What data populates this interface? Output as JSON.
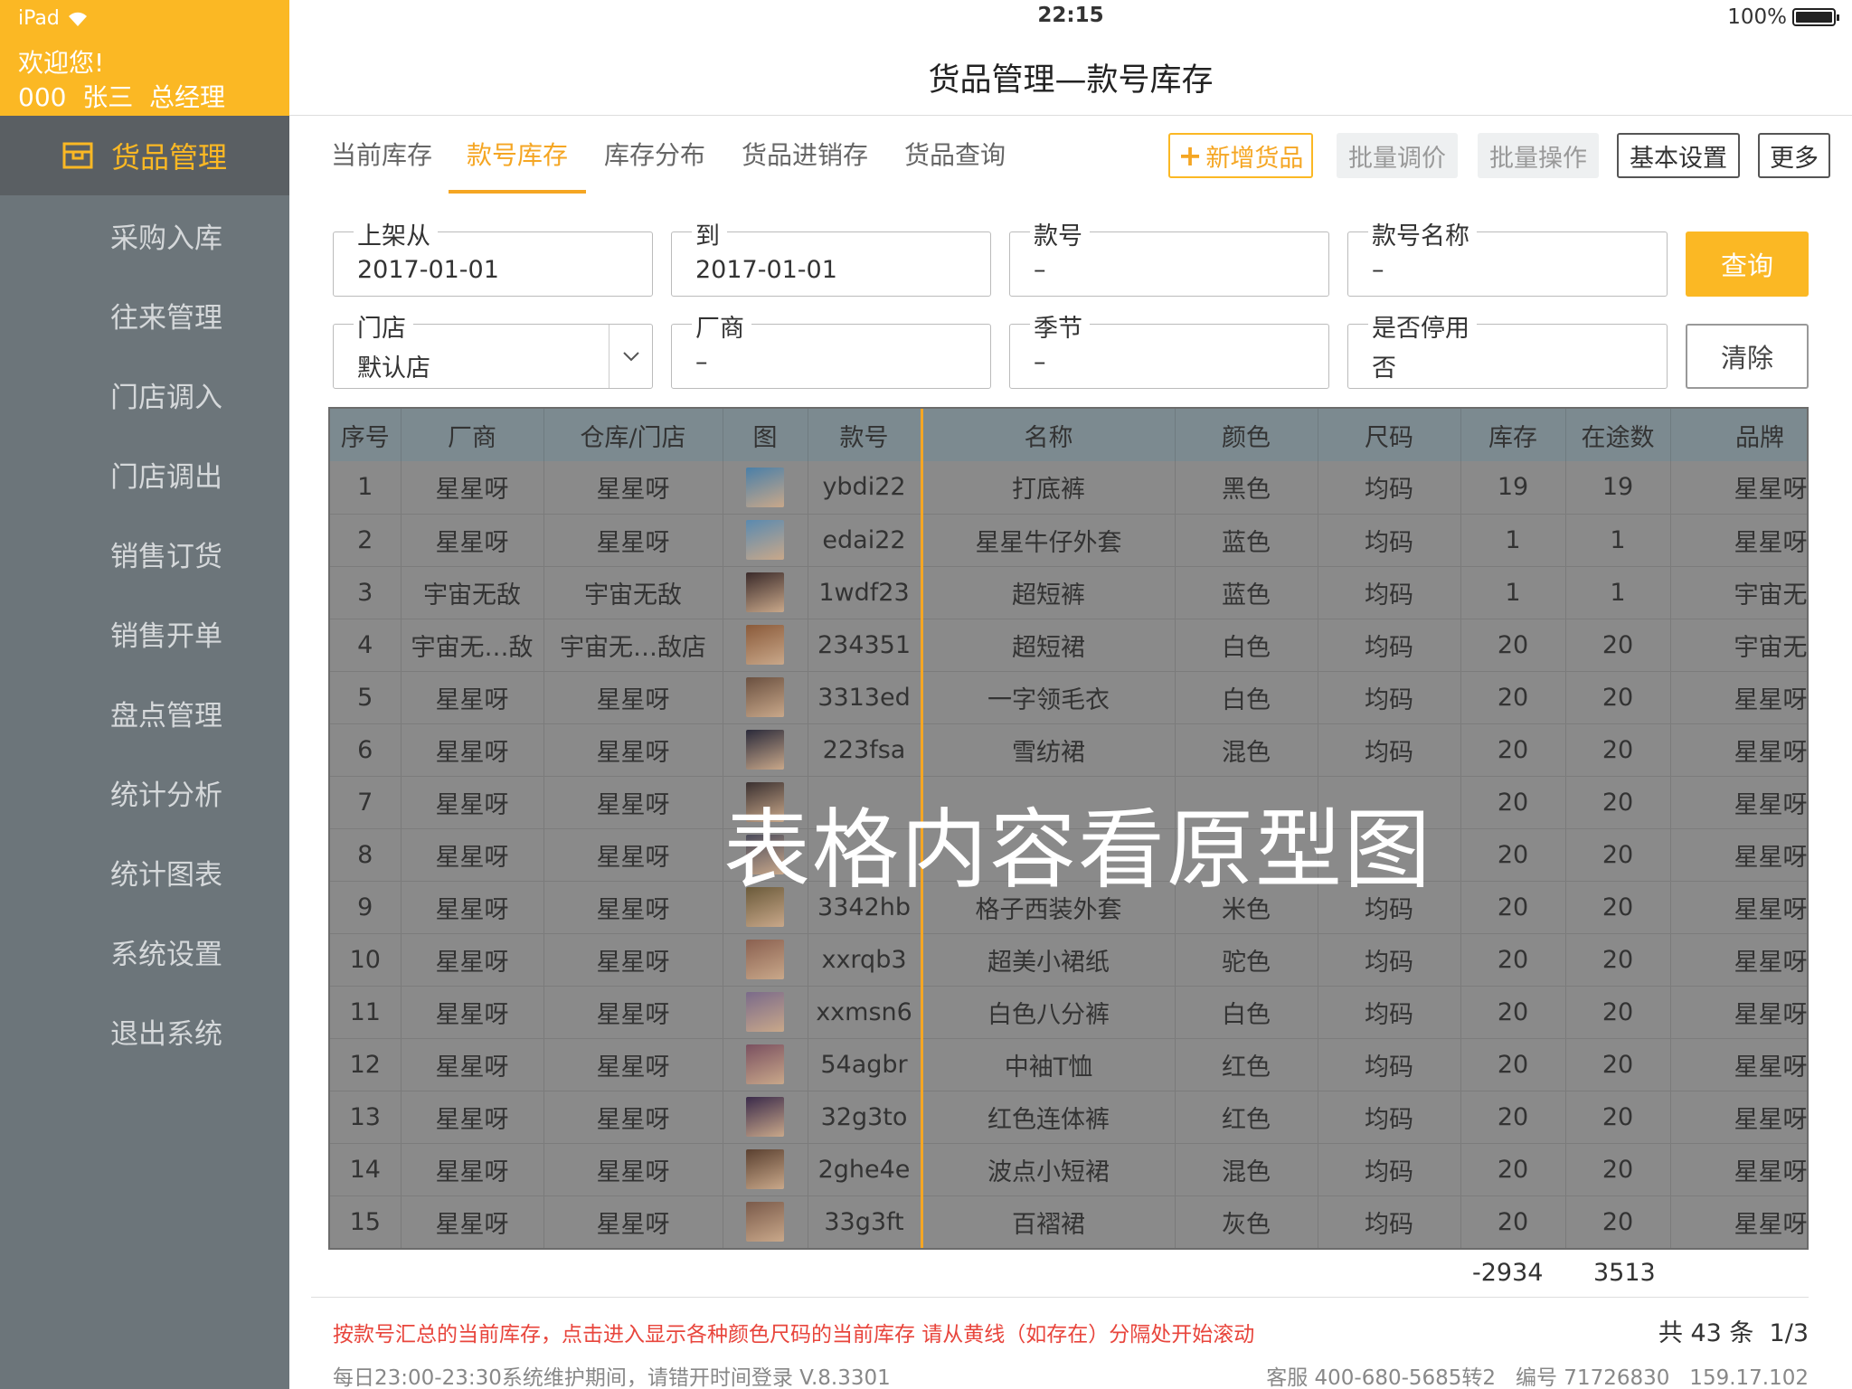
{
  "status": {
    "device": "iPad",
    "time": "22:15",
    "battery": "100%"
  },
  "user": {
    "welcome": "欢迎您!",
    "line": "000  张三  总经理"
  },
  "sidebar": {
    "active": "货品管理",
    "items": [
      "采购入库",
      "往来管理",
      "门店调入",
      "门店调出",
      "销售订货",
      "销售开单",
      "盘点管理",
      "统计分析",
      "统计图表",
      "系统设置",
      "退出系统"
    ]
  },
  "page_title": "货品管理—款号库存",
  "tabs": [
    "当前库存",
    "款号库存",
    "库存分布",
    "货品进销存",
    "货品查询"
  ],
  "actions": {
    "add": "新增货品",
    "batch_price": "批量调价",
    "batch_op": "批量操作",
    "settings": "基本设置",
    "more": "更多"
  },
  "filters": {
    "shelf_from": {
      "label": "上架从",
      "value": "2017-01-01"
    },
    "to": {
      "label": "到",
      "value": "2017-01-01"
    },
    "style_no": {
      "label": "款号",
      "value": "–"
    },
    "style_name": {
      "label": "款号名称",
      "value": "–"
    },
    "store": {
      "label": "门店",
      "value": "默认店"
    },
    "vendor": {
      "label": "厂商",
      "value": "–"
    },
    "season": {
      "label": "季节",
      "value": "–"
    },
    "disabled": {
      "label": "是否停用",
      "value": "否"
    }
  },
  "buttons": {
    "query": "查询",
    "clear": "清除"
  },
  "table": {
    "headers": [
      "序号",
      "厂商",
      "仓库/门店",
      "图",
      "款号",
      "名称",
      "颜色",
      "尺码",
      "库存",
      "在途数",
      "品牌"
    ],
    "rows": [
      [
        "1",
        "星星呀",
        "星星呀",
        "ybdi22",
        "打底裤",
        "黑色",
        "均码",
        "19",
        "19",
        "星星呀"
      ],
      [
        "2",
        "星星呀",
        "星星呀",
        "edai22",
        "星星牛仔外套",
        "蓝色",
        "均码",
        "1",
        "1",
        "星星呀"
      ],
      [
        "3",
        "宇宙无敌",
        "宇宙无敌",
        "1wdf23",
        "超短裤",
        "蓝色",
        "均码",
        "1",
        "1",
        "宇宙无敌"
      ],
      [
        "4",
        "宇宙无…敌",
        "宇宙无…敌店",
        "234351",
        "超短裙",
        "白色",
        "均码",
        "20",
        "20",
        "宇宙无…敌"
      ],
      [
        "5",
        "星星呀",
        "星星呀",
        "3313ed",
        "一字领毛衣",
        "白色",
        "均码",
        "20",
        "20",
        "星星呀"
      ],
      [
        "6",
        "星星呀",
        "星星呀",
        "223fsa",
        "雪纺裙",
        "混色",
        "均码",
        "20",
        "20",
        "星星呀"
      ],
      [
        "7",
        "星星呀",
        "星星呀",
        "",
        "",
        "",
        "",
        "20",
        "20",
        "星星呀"
      ],
      [
        "8",
        "星星呀",
        "星星呀",
        "",
        "",
        "",
        "",
        "20",
        "20",
        "星星呀"
      ],
      [
        "9",
        "星星呀",
        "星星呀",
        "3342hb",
        "格子西装外套",
        "米色",
        "均码",
        "20",
        "20",
        "星星呀"
      ],
      [
        "10",
        "星星呀",
        "星星呀",
        "xxrqb3",
        "超美小裙纸",
        "驼色",
        "均码",
        "20",
        "20",
        "星星呀"
      ],
      [
        "11",
        "星星呀",
        "星星呀",
        "xxmsn6",
        "白色八分裤",
        "白色",
        "均码",
        "20",
        "20",
        "星星呀"
      ],
      [
        "12",
        "星星呀",
        "星星呀",
        "54agbr",
        "中袖T恤",
        "红色",
        "均码",
        "20",
        "20",
        "星星呀"
      ],
      [
        "13",
        "星星呀",
        "星星呀",
        "32g3to",
        "红色连体裤",
        "红色",
        "均码",
        "20",
        "20",
        "星星呀"
      ],
      [
        "14",
        "星星呀",
        "星星呀",
        "2ghe4e",
        "波点小短裙",
        "混色",
        "均码",
        "20",
        "20",
        "星星呀"
      ],
      [
        "15",
        "星星呀",
        "星星呀",
        "33g3ft",
        "百褶裙",
        "灰色",
        "均码",
        "20",
        "20",
        "星星呀"
      ]
    ]
  },
  "watermark": "表格内容看原型图",
  "totals": {
    "stock": "-2934",
    "in_transit": "3513"
  },
  "hint": "按款号汇总的当前库存，点击进入显示各种颜色尺码的当前库存  请从黄线（如存在）分隔处开始滚动",
  "pager": "共 43 条  1/3",
  "maintenance": "每日23:00-23:30系统维护期间，请错开时间登录 V.8.3301",
  "service": "客服 400-680-5685转2   编号 71726830   159.17.102"
}
